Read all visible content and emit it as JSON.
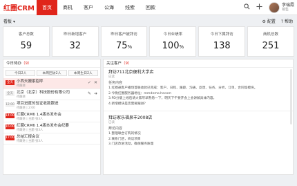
{
  "brand": {
    "logo": "红圈CRM",
    "accent": "#e0251b"
  },
  "nav": [
    "首页",
    "商机",
    "客户",
    "公海",
    "线索",
    "回款"
  ],
  "user": {
    "name": "李瑞霞",
    "role": "销售"
  },
  "board_label": "看板",
  "header_actions": {
    "config": "配置",
    "help": "帮助"
  },
  "stats": [
    {
      "label": "客户总数",
      "value": "59"
    },
    {
      "label": "昨日新增客户",
      "value": "32"
    },
    {
      "label": "昨日客户被拜访",
      "value": "75",
      "unit": "%"
    },
    {
      "label": "今日业绩率",
      "value": "100",
      "unit": "%"
    },
    {
      "label": "今日下属拜访",
      "value": "138"
    },
    {
      "label": "商机总数",
      "value": "251"
    }
  ],
  "todo": {
    "title": "今日待办",
    "count": "（9）",
    "filters": [
      "今日2人",
      "本周回访2人",
      "本周生日2人"
    ],
    "items": [
      {
        "tag": "全天",
        "tag_style": "red",
        "title": "小西天搬家招呼",
        "sub": "待跟进",
        "selected": true
      },
      {
        "tag": "全天",
        "tag_style": "gray",
        "title": "北京（北京）科技股份有限公司",
        "sub": "待跟进"
      },
      {
        "tag": "12:00",
        "tag_style": "gray",
        "title": "项目进度的验证收款跟进",
        "sub": "待跟进 | 2:00"
      },
      {
        "tag": "14:00",
        "tag_style": "red",
        "title": "红圈CRM6 1.4版本发布会",
        "sub": "待跟进 | 主题 张3人"
      },
      {
        "tag": "16:00",
        "tag_style": "red",
        "title": "红圈CRM6 1.4版本发布会纪要",
        "sub": "待跟进 | 主题 张3人"
      },
      {
        "tag": "17:00",
        "tag_style": "red",
        "title": "总结汇报会议",
        "sub": "待跟进 | 主题 张3人"
      }
    ]
  },
  "feed": {
    "title": "关注客户",
    "count": "（9）",
    "items": [
      {
        "title": "拜访711北京便利大学店",
        "meta": "已读",
        "section": "任务内容",
        "lines": [
          "1.红圈通客户播场首联收款已完成：客户、日程、跟踪、沟通、反馈、任务、分析、订单、合同等模块。",
          "2.今晚红圈服务器地址：mmdemo.hecom",
          "3.PD分版上线后请大家尽早熟悉一下，明天下午要开会上会讲解具体内容。",
          "4.新增模块是否需要跟进？"
        ]
      },
      {
        "title": "拜访家乐福泉丰2008店",
        "meta": "已读",
        "section": "拜访内容",
        "lines": [
          "1.整理联合订购的情况",
          "2.联系门店，商议项目",
          "3.门店改进活动，确保服务质量"
        ]
      }
    ]
  }
}
